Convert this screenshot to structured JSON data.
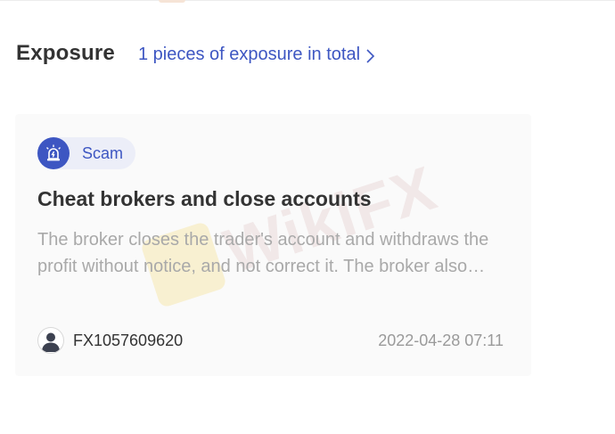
{
  "header": {
    "title": "Exposure",
    "exposure_link": "1 pieces of exposure in total"
  },
  "exposure_card": {
    "tag": {
      "label": "Scam",
      "icon": "alarm-light-icon"
    },
    "title": "Cheat brokers and close accounts",
    "description": "The broker closes the trader's account and withdraws the profit without notice, and not correct it. The broker also refuses to respond.",
    "user": {
      "name": "FX1057609620",
      "avatar_icon": "user-avatar-icon"
    },
    "timestamp": "2022-04-28 07:11",
    "watermark": "WikiFX"
  },
  "colors": {
    "accent": "#3d56c2",
    "tag_background": "#eceef8",
    "card_background": "#fafafa",
    "title_text": "#333333",
    "muted_text": "#a9a9a9"
  }
}
